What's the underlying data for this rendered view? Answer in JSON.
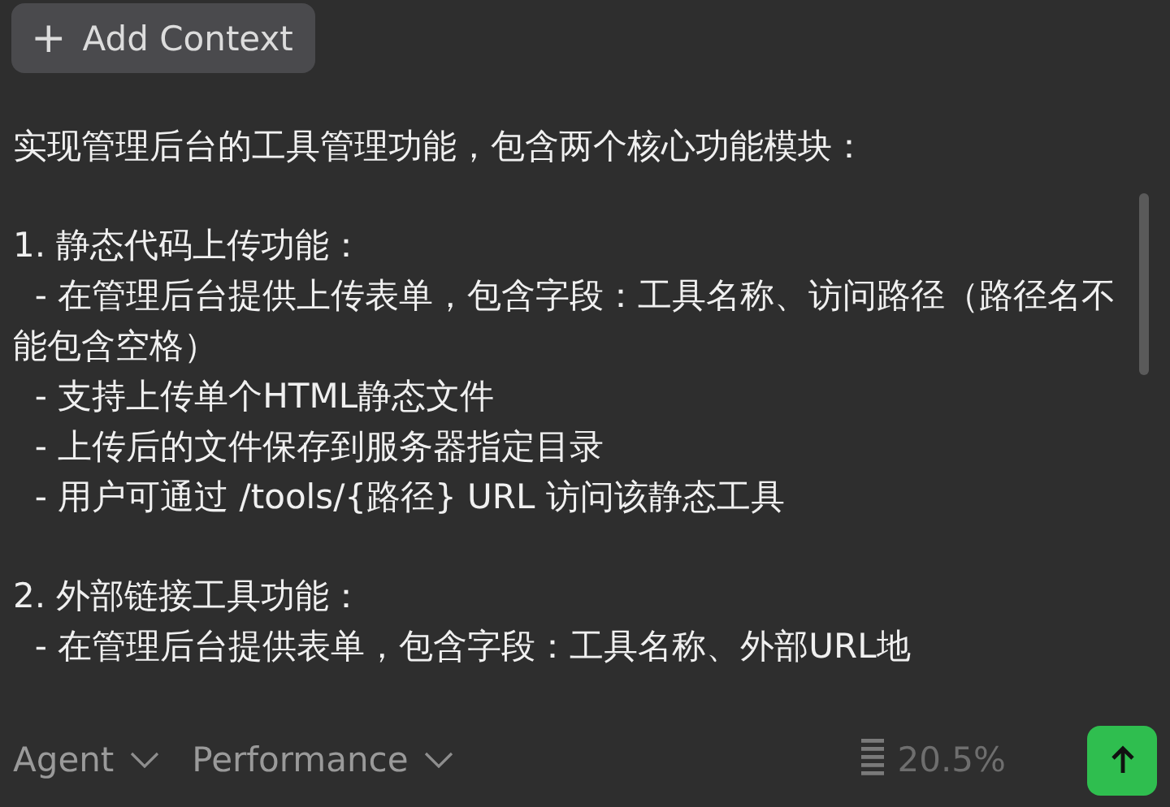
{
  "add_context_button": {
    "icon": "+",
    "label": "Add Context"
  },
  "prompt": {
    "paragraphs": [
      {
        "lines": [
          "实现管理后台的工具管理功能，包含两个核心功能模块："
        ]
      },
      {
        "lines": [
          "1. 静态代码上传功能：",
          "  - 在管理后台提供上传表单，包含字段：工具名称、访问路径（路径名不能包含空格）",
          "  - 支持上传单个HTML静态文件",
          "  - 上传后的文件保存到服务器指定目录",
          "  - 用户可通过 /tools/{路径} URL 访问该静态工具"
        ]
      },
      {
        "lines": [
          "2. 外部链接工具功能：",
          "  - 在管理后台提供表单，包含字段：工具名称、外部URL地"
        ]
      }
    ]
  },
  "footer": {
    "mode": "Agent",
    "model": "Performance",
    "usage": "20.5%"
  }
}
